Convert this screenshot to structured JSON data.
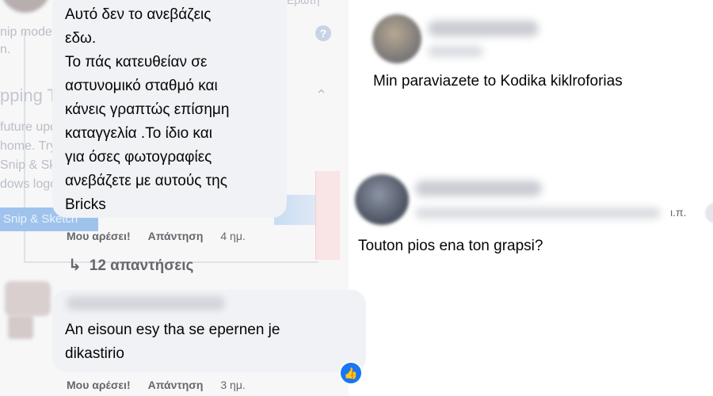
{
  "background_window": {
    "title": "pping Tool is moving...",
    "line1": "nip mode using the Mode button or click the",
    "line2": "n.",
    "line3": "future update, Snipping Tool will be moving to a",
    "line4": "home. Try improved features and snip like usual",
    "line5": "Snip & Sketch (or try the shortcut",
    "line6": "dows logo key + Shift + S).",
    "button": "Snip & Sketch",
    "topright": "Ερώτη",
    "help_icon": "question-circle-icon",
    "chevron_icon": "chevron-up-icon"
  },
  "comments": [
    {
      "text": "Αυτό δεν το ανεβάζεις\nεδω.\nΤο πάς κατευθείαν σε\nαστυνομικό σταθμό και\nκάνεις γραπτώς επίσημη\nκαταγγελία .Το ίδιο και\nγια όσες φωτογραφίες\nανεβάζετε με αυτούς της\nBricks",
      "like": "Μου αρέσει!",
      "reply": "Απάντηση",
      "time": "4 ημ.",
      "replies_count": "12 απαντήσεις"
    },
    {
      "text": "An eisoun esy tha se epernen je\ndikastirio",
      "like": "Μου αρέσει!",
      "reply": "Απάντηση",
      "time": "3 ημ.",
      "reaction_icon": "thumbs-up-icon"
    }
  ],
  "right_comments": [
    {
      "text": "Min paraviazete to Kodika kiklroforias"
    },
    {
      "text": "Touton pios ena ton grapsi?",
      "time_fragment": "ι.π."
    }
  ]
}
